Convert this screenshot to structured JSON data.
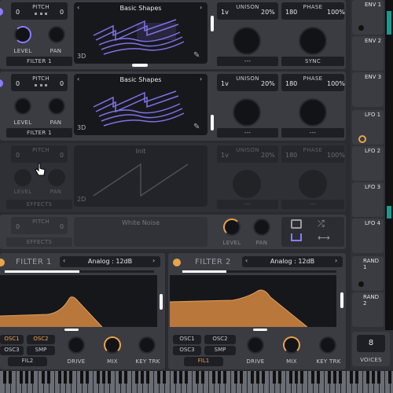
{
  "colors": {
    "accent": "#8a7cff",
    "orange": "#e9a34a",
    "filter_fill": "#b9773c",
    "bg": "#2a2b30"
  },
  "osc1": {
    "pitch_label": "PITCH",
    "pitch_value": "0",
    "level_label": "LEVEL",
    "pan_label": "PAN",
    "dest": "FILTER 1",
    "wavetable": "Basic Shapes",
    "mode": "3D",
    "unison_voices": "1v",
    "unison_label": "UNISON",
    "unison_detune": "20%",
    "phase_value": "180",
    "phase_label": "PHASE",
    "phase_rand": "100%",
    "knob1_label": "---",
    "knob2_label": "SYNC"
  },
  "osc2": {
    "pitch_label": "PITCH",
    "pitch_value": "0",
    "level_label": "LEVEL",
    "pan_label": "PAN",
    "dest": "FILTER 1",
    "wavetable": "Basic Shapes",
    "mode": "3D",
    "unison_voices": "1v",
    "unison_label": "UNISON",
    "unison_detune": "20%",
    "phase_value": "180",
    "phase_label": "PHASE",
    "phase_rand": "100%",
    "knob1_label": "---",
    "knob2_label": "---"
  },
  "osc3": {
    "pitch_label": "PITCH",
    "pitch_value": "0",
    "level_label": "LEVEL",
    "pan_label": "PAN",
    "dest": "EFFECTS",
    "wavetable": "Init",
    "mode": "2D",
    "unison_voices": "1v",
    "unison_label": "UNISON",
    "unison_detune": "20%",
    "phase_value": "180",
    "phase_label": "PHASE",
    "phase_rand": "100%",
    "knob1_label": "---",
    "knob2_label": "---"
  },
  "sample": {
    "pitch_label": "PITCH",
    "pitch_value": "0",
    "dest": "EFFECTS",
    "name": "White Noise",
    "level_label": "LEVEL",
    "pan_label": "PAN"
  },
  "filter1": {
    "title": "FILTER 1",
    "model": "Analog : 12dB",
    "osc1": "OSC1",
    "osc2": "OSC2",
    "osc3": "OSC3",
    "smp": "SMP",
    "fil": "FIL2",
    "drive": "DRIVE",
    "mix": "MIX",
    "keytrk": "KEY TRK"
  },
  "filter2": {
    "title": "FILTER 2",
    "model": "Analog : 12dB",
    "osc1": "OSC1",
    "osc2": "OSC2",
    "osc3": "OSC3",
    "smp": "SMP",
    "fil": "FIL1",
    "drive": "DRIVE",
    "mix": "MIX",
    "keytrk": "KEY TRK"
  },
  "sidebar": {
    "env1": "ENV 1",
    "env2": "ENV 2",
    "env3": "ENV 3",
    "lfo1": "LFO 1",
    "lfo2": "LFO 2",
    "lfo3": "LFO 3",
    "lfo4": "LFO 4",
    "rand1": "RAND 1",
    "rand2": "RAND 2",
    "voices_value": "8",
    "voices_label": "VOICES"
  }
}
